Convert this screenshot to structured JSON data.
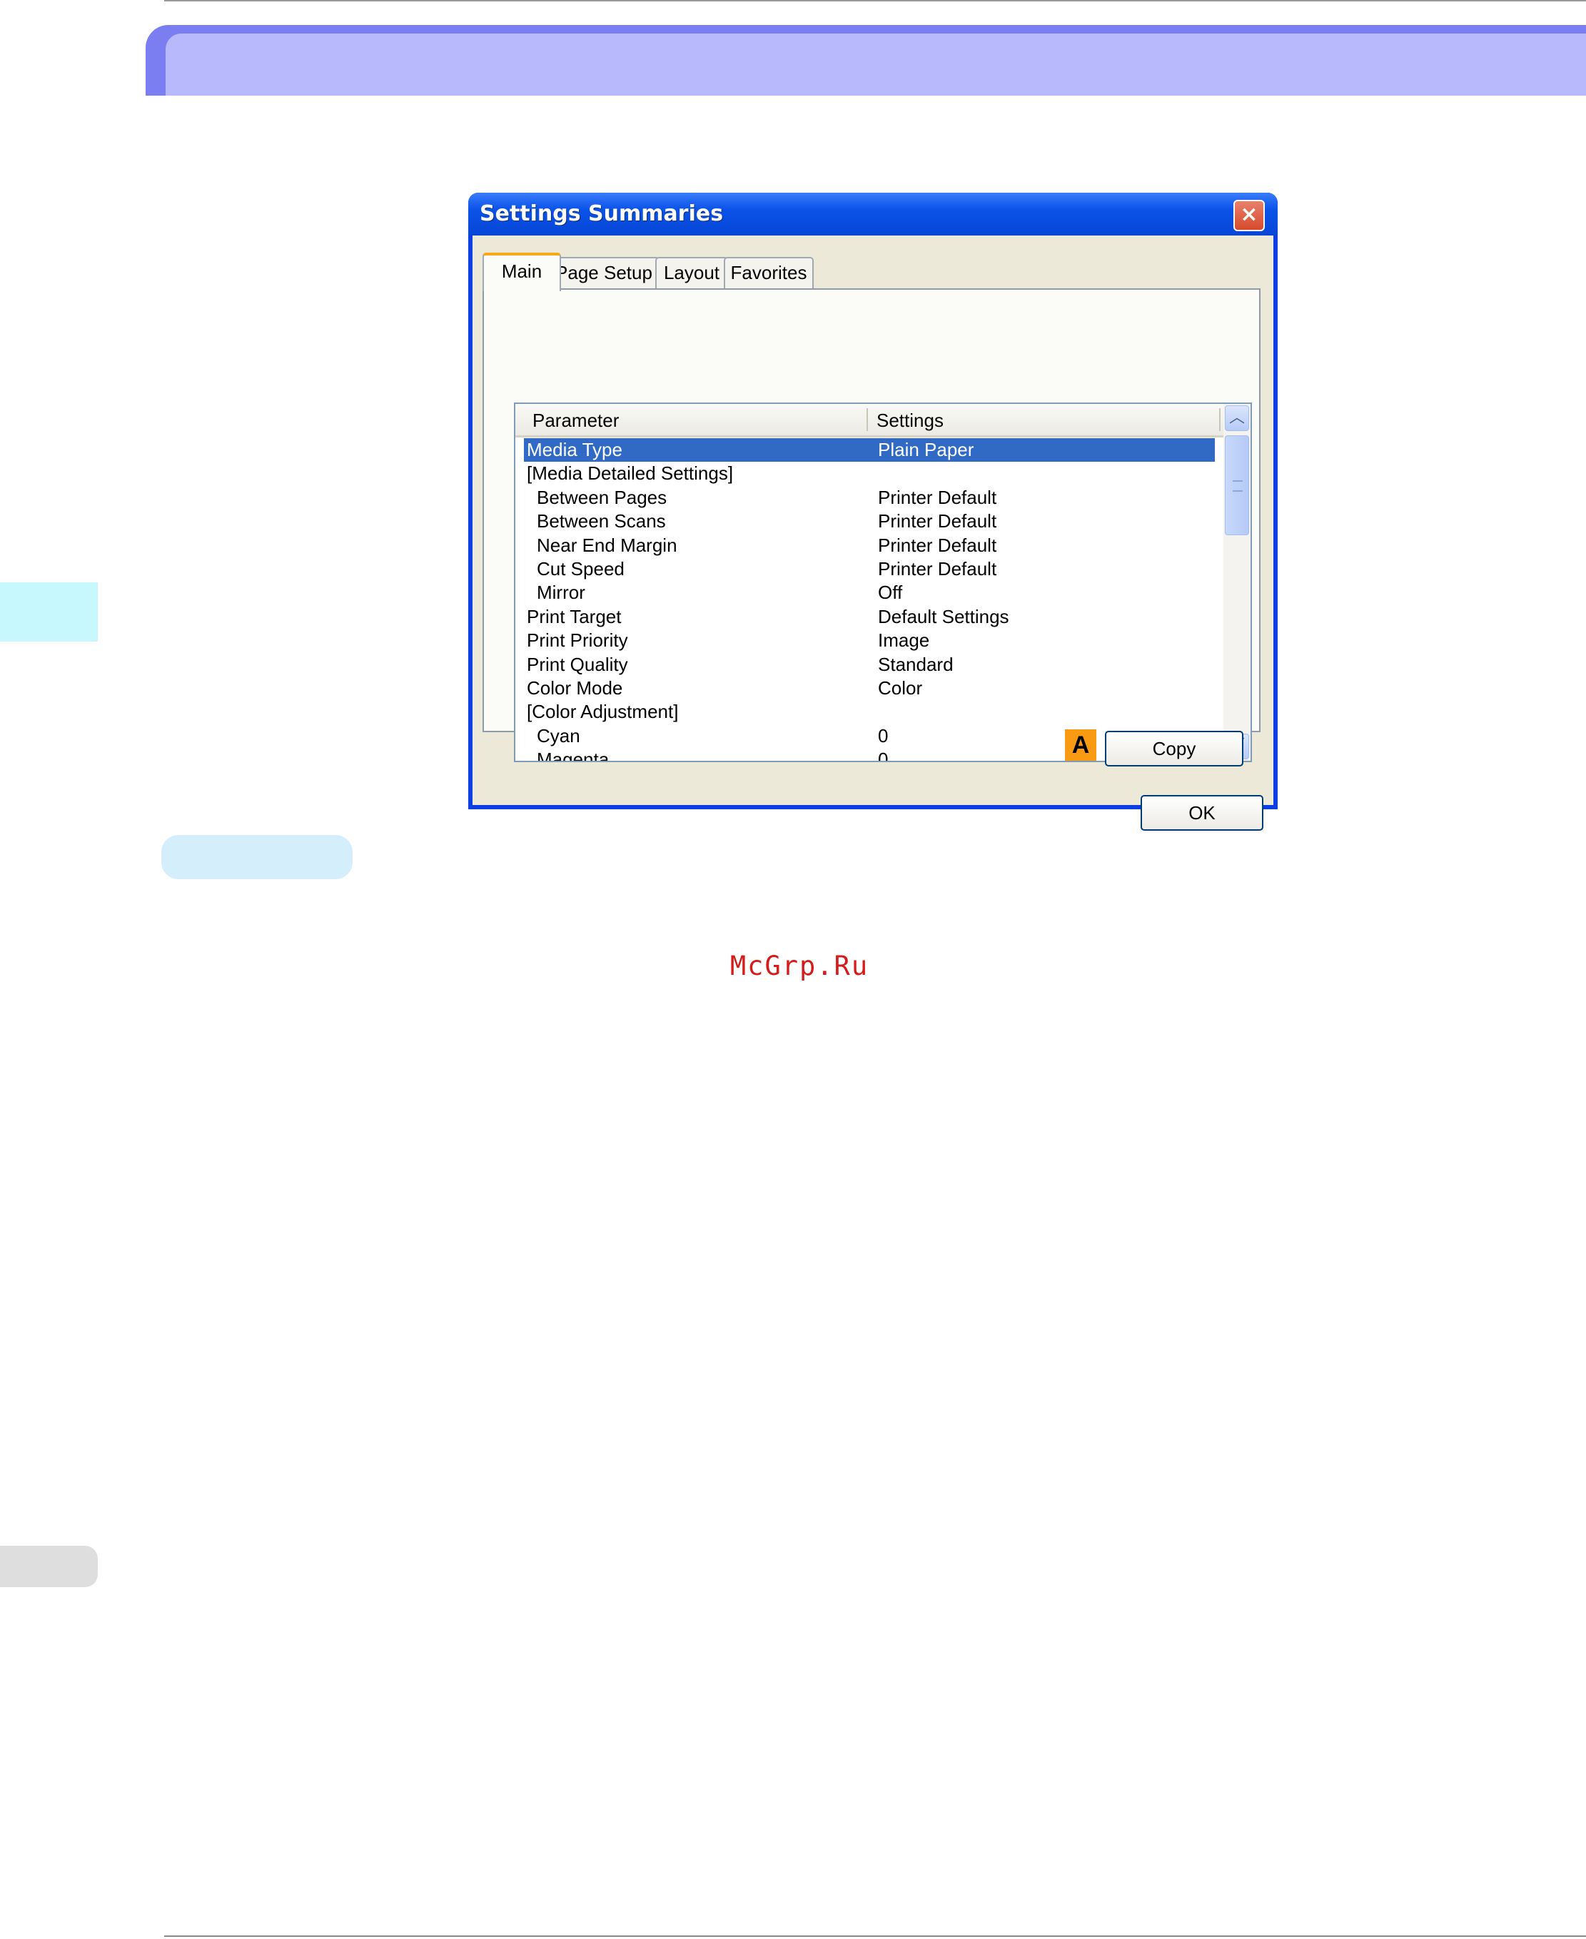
{
  "dialog": {
    "title": "Settings Summaries",
    "close_label": "×",
    "tabs": [
      {
        "label": "Main",
        "active": true
      },
      {
        "label": "Page Setup",
        "active": false
      },
      {
        "label": "Layout",
        "active": false
      },
      {
        "label": "Favorites",
        "active": false
      }
    ],
    "list": {
      "columns": [
        "Parameter",
        "Settings"
      ],
      "rows": [
        {
          "param": "Media Type",
          "value": "Plain Paper",
          "selected": true,
          "indent": false
        },
        {
          "param": "[Media Detailed Settings]",
          "value": "",
          "selected": false,
          "indent": false
        },
        {
          "param": "Between Pages",
          "value": "Printer Default",
          "selected": false,
          "indent": true
        },
        {
          "param": "Between Scans",
          "value": "Printer Default",
          "selected": false,
          "indent": true
        },
        {
          "param": "Near End Margin",
          "value": "Printer Default",
          "selected": false,
          "indent": true
        },
        {
          "param": "Cut Speed",
          "value": "Printer Default",
          "selected": false,
          "indent": true
        },
        {
          "param": "Mirror",
          "value": "Off",
          "selected": false,
          "indent": true
        },
        {
          "param": "Print Target",
          "value": "Default Settings",
          "selected": false,
          "indent": false
        },
        {
          "param": "Print Priority",
          "value": "Image",
          "selected": false,
          "indent": false
        },
        {
          "param": "Print Quality",
          "value": "Standard",
          "selected": false,
          "indent": false
        },
        {
          "param": "Color Mode",
          "value": "Color",
          "selected": false,
          "indent": false
        },
        {
          "param": "[Color Adjustment]",
          "value": "",
          "selected": false,
          "indent": false
        },
        {
          "param": "Cyan",
          "value": "0",
          "selected": false,
          "indent": true
        },
        {
          "param": "Magenta",
          "value": "0",
          "selected": false,
          "indent": true
        }
      ]
    },
    "callout": "A",
    "copy_label": "Copy",
    "ok_label": "OK"
  },
  "watermark": "McGrp.Ru",
  "colors": {
    "header_bar": "#b7b9fc",
    "selection": "#316ac5",
    "titlebar": "#0a52e8",
    "callout": "#f89a12"
  }
}
